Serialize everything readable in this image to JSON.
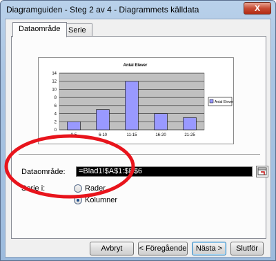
{
  "window": {
    "title": "Diagramguiden - Steg 2 av 4 - Diagrammets källdata",
    "close_label": "X"
  },
  "tabs": [
    {
      "label": "Dataområde",
      "active": true
    },
    {
      "label": "Serie",
      "active": false
    }
  ],
  "chart_data": {
    "type": "bar",
    "title": "Antal Elever",
    "categories": [
      "0-5",
      "6-10",
      "11-15",
      "16-20",
      "21-25"
    ],
    "series": [
      {
        "name": "Antal Elever",
        "values": [
          2,
          5,
          12,
          4,
          3
        ]
      }
    ],
    "ylim": [
      0,
      14
    ],
    "yticks": [
      0,
      2,
      4,
      6,
      8,
      10,
      12,
      14
    ],
    "grid": true,
    "legend": "right",
    "colors": {
      "bar": "#9999ff",
      "plot_bg": "#c0c0c0"
    }
  },
  "form": {
    "range_label": "Dataområde:",
    "range_value": "=Blad1!$A$1:$B$6",
    "series_label": "Serie i:",
    "options": [
      {
        "label": "Rader",
        "checked": false
      },
      {
        "label": "Kolumner",
        "checked": true
      }
    ]
  },
  "buttons": {
    "cancel": "Avbryt",
    "back": "< Föregående",
    "next": "Nästa >",
    "finish": "Slutför"
  },
  "annotation_color": "#e8141c"
}
